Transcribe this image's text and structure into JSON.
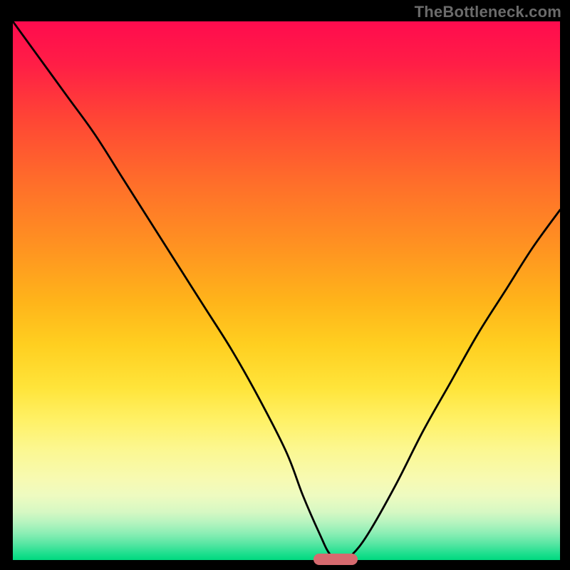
{
  "watermark": "TheBottleneck.com",
  "chart_data": {
    "type": "line",
    "title": "",
    "xlabel": "",
    "ylabel": "",
    "xlim": [
      0,
      100
    ],
    "ylim": [
      0,
      100
    ],
    "grid": false,
    "x": [
      0,
      5,
      10,
      15,
      20,
      25,
      30,
      35,
      40,
      45,
      50,
      53,
      56,
      58,
      60,
      62,
      65,
      70,
      75,
      80,
      85,
      90,
      95,
      100
    ],
    "values": [
      100,
      93,
      86,
      79,
      71,
      63,
      55,
      47,
      39,
      30,
      20,
      12,
      5,
      1,
      0,
      1,
      5,
      14,
      24,
      33,
      42,
      50,
      58,
      65
    ],
    "annotations": [
      {
        "type": "marker",
        "x_start": 55,
        "x_end": 63,
        "y": 0,
        "color": "#d66a6f"
      }
    ]
  },
  "colors": {
    "frame_bg": "#000000",
    "curve": "#000000",
    "marker": "#d66a6f",
    "watermark": "#6b6b6b"
  }
}
